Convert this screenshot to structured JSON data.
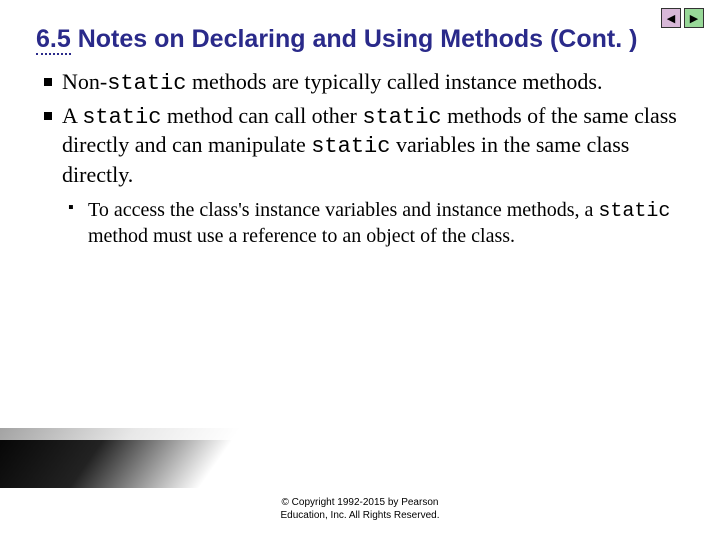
{
  "nav": {
    "prev_glyph": "◀",
    "next_glyph": "▶"
  },
  "title": {
    "number": "6.5",
    "text": "Notes on Declaring and Using Methods (Cont. )"
  },
  "bullets": [
    {
      "pre": "Non-",
      "code1": "static",
      "post": " methods are typically called instance methods."
    },
    {
      "pre": "A ",
      "code1": "static",
      "mid1": " method can call other ",
      "code2": "static",
      "mid2": " methods of the same class directly and can manipulate ",
      "code3": "static",
      "post": " variables in the same class directly."
    }
  ],
  "sub": {
    "pre": "To access the class's instance variables and instance methods, a ",
    "code1": "static",
    "post": " method must use a reference to an object of the class."
  },
  "copyright": {
    "line1": "© Copyright 1992-2015 by Pearson",
    "line2": "Education, Inc. All Rights Reserved."
  }
}
